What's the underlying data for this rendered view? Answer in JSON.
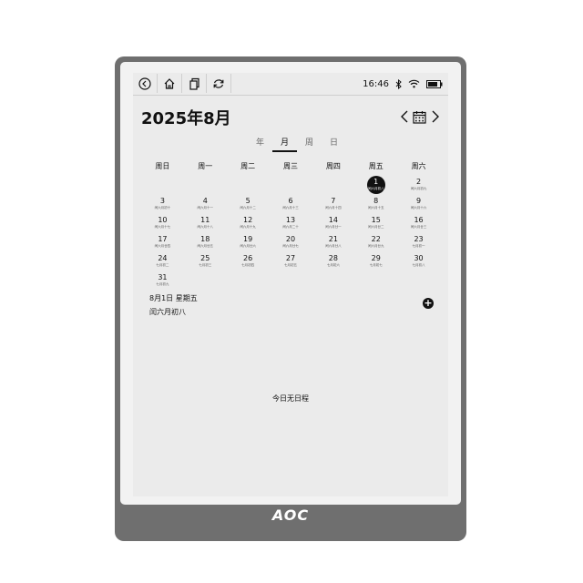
{
  "device": {
    "brand": "AOC"
  },
  "status": {
    "time": "16:46"
  },
  "header": {
    "title": "2025年8月",
    "view_tabs": [
      "年",
      "月",
      "周",
      "日"
    ],
    "active_tab": "月"
  },
  "calendar": {
    "weekdays": [
      "周日",
      "周一",
      "周二",
      "周三",
      "周四",
      "周五",
      "周六"
    ],
    "leading_blanks": 5,
    "today": 1,
    "days": [
      {
        "n": "1",
        "sub": "闰六月初八"
      },
      {
        "n": "2",
        "sub": "闰六月初九"
      },
      {
        "n": "3",
        "sub": "闰六月初十"
      },
      {
        "n": "4",
        "sub": "闰六月十一"
      },
      {
        "n": "5",
        "sub": "闰六月十二"
      },
      {
        "n": "6",
        "sub": "闰六月十三"
      },
      {
        "n": "7",
        "sub": "闰六月十四"
      },
      {
        "n": "8",
        "sub": "闰六月十五"
      },
      {
        "n": "9",
        "sub": "闰六月十六"
      },
      {
        "n": "10",
        "sub": "闰六月十七"
      },
      {
        "n": "11",
        "sub": "闰六月十八"
      },
      {
        "n": "12",
        "sub": "闰六月十九"
      },
      {
        "n": "13",
        "sub": "闰六月二十"
      },
      {
        "n": "14",
        "sub": "闰六月廿一"
      },
      {
        "n": "15",
        "sub": "闰六月廿二"
      },
      {
        "n": "16",
        "sub": "闰六月廿三"
      },
      {
        "n": "17",
        "sub": "闰六月廿四"
      },
      {
        "n": "18",
        "sub": "闰六月廿五"
      },
      {
        "n": "19",
        "sub": "闰六月廿六"
      },
      {
        "n": "20",
        "sub": "闰六月廿七"
      },
      {
        "n": "21",
        "sub": "闰六月廿八"
      },
      {
        "n": "22",
        "sub": "闰六月廿九"
      },
      {
        "n": "23",
        "sub": "七月初一"
      },
      {
        "n": "24",
        "sub": "七月初二"
      },
      {
        "n": "25",
        "sub": "七月初三"
      },
      {
        "n": "26",
        "sub": "七月初四"
      },
      {
        "n": "27",
        "sub": "七月初五"
      },
      {
        "n": "28",
        "sub": "七月初六"
      },
      {
        "n": "29",
        "sub": "七月初七"
      },
      {
        "n": "30",
        "sub": "七月初八"
      },
      {
        "n": "31",
        "sub": "七月初九"
      }
    ]
  },
  "selected": {
    "date_line": "8月1日 星期五",
    "lunar_line": "闰六月初八"
  },
  "events": {
    "empty_message": "今日无日程",
    "add_label": "+"
  },
  "icons": {
    "back": "back-icon",
    "home": "home-icon",
    "windows": "multitask-icon",
    "refresh": "refresh-icon",
    "bluetooth": "bluetooth-icon",
    "wifi": "wifi-icon",
    "battery": "battery-icon",
    "prev": "chevron-left-icon",
    "calendar": "calendar-icon",
    "next": "chevron-right-icon",
    "add": "plus-circle-icon"
  }
}
